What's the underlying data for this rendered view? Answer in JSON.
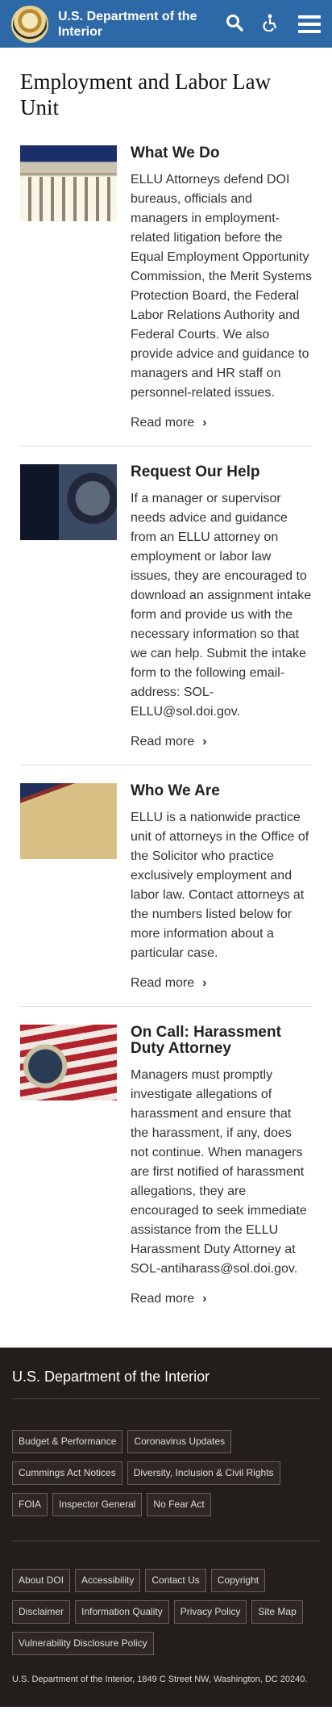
{
  "header": {
    "agency_name": "U.S. Department of the Interior",
    "icons": {
      "search": "search-icon",
      "accessibility": "accessibility-icon",
      "menu": "menu-icon"
    }
  },
  "main": {
    "title": "Employment and Labor Law Unit",
    "cards": [
      {
        "title": "What We Do",
        "text": "ELLU Attorneys defend DOI bureaus, officials and managers in employment-related litigation before the Equal Employment Opportunity Commission, the Merit Systems Protection Board, the Federal Labor Relations Authority and Federal Courts. We also provide advice and guidance to managers and HR staff on personnel-related issues.",
        "link": "Read more"
      },
      {
        "title": "Request Our Help",
        "text": "If a manager or supervisor needs advice and guidance from an ELLU attorney on employment or labor law issues, they are encouraged to download an assignment intake form and provide us with the necessary information so that we can help. Submit the intake form to the following email-address: SOL-ELLU@sol.doi.gov.",
        "link": "Read more"
      },
      {
        "title": "Who We Are",
        "text": "ELLU is a nationwide practice unit of attorneys in the Office of the Solicitor who practice exclusively employment and labor law. Contact attorneys at the numbers listed below for more information about a particular case.",
        "link": "Read more"
      },
      {
        "title": "On Call: Harassment Duty Attorney",
        "text": "Managers must promptly investigate allegations of harassment and ensure that the harassment, if any, does not continue. When managers are first notified of harassment allegations, they are encouraged to seek immediate assistance from the ELLU Harassment Duty Attorney at SOL-antiharass@sol.doi.gov.",
        "link": "Read more"
      }
    ]
  },
  "footer": {
    "title": "U.S. Department of the Interior",
    "links_primary": [
      "Budget & Performance",
      "Coronavirus Updates",
      "Cummings Act Notices",
      "Diversity, Inclusion & Civil Rights",
      "FOIA",
      "Inspector General",
      "No Fear Act"
    ],
    "links_secondary": [
      "About DOI",
      "Accessibility",
      "Contact Us",
      "Copyright",
      "Disclaimer",
      "Information Quality",
      "Privacy Policy",
      "Site Map",
      "Vulnerability Disclosure Policy"
    ],
    "address": "U.S. Department of the Interior, 1849 C Street NW, Washington, DC 20240."
  }
}
